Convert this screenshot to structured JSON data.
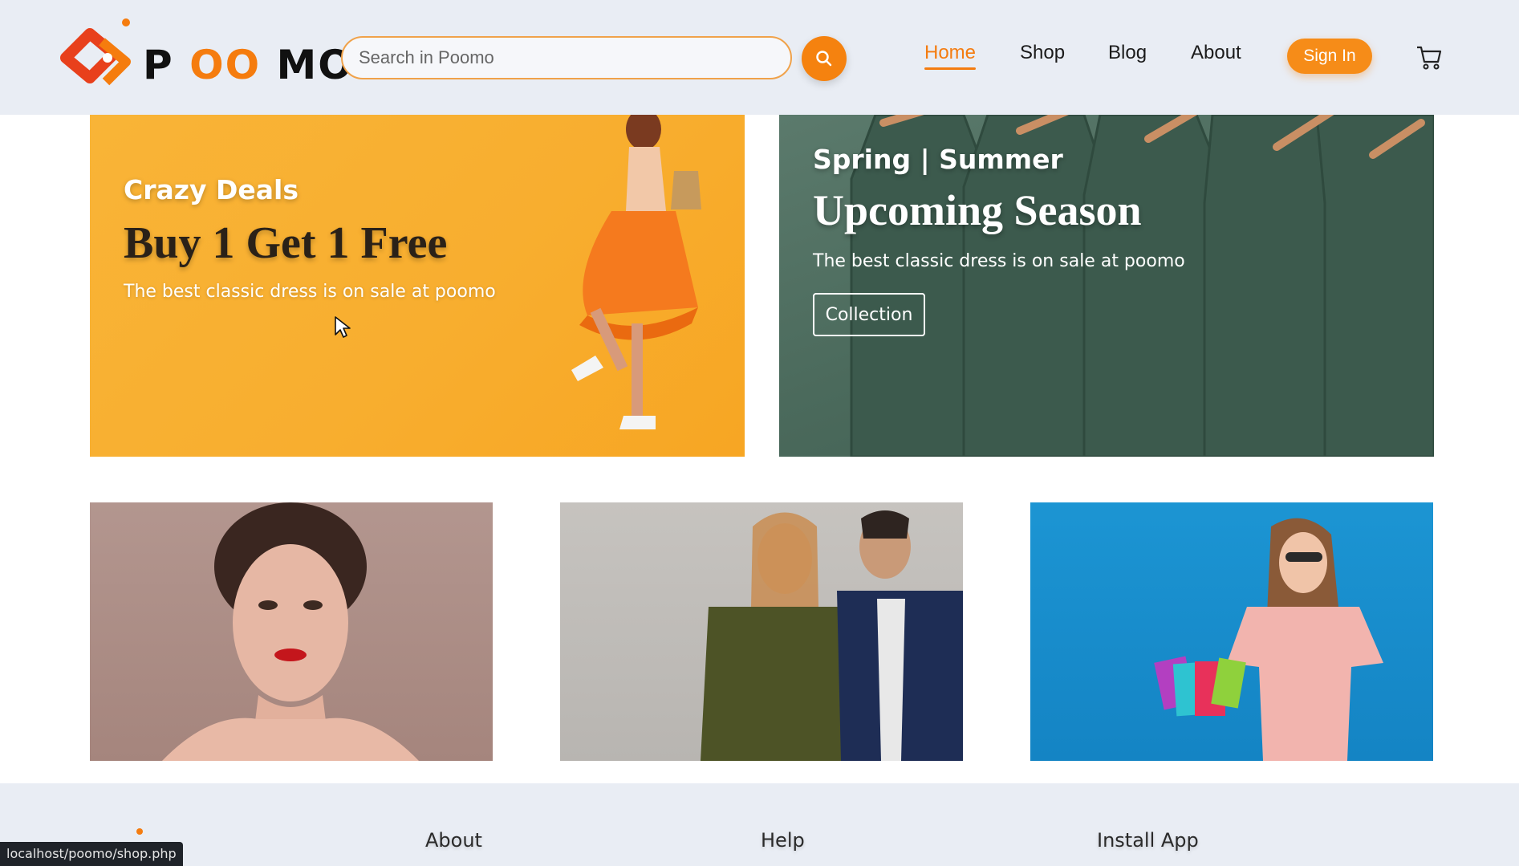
{
  "header": {
    "logo": {
      "text_left": "P",
      "text_mid": "OO",
      "text_right": "MO"
    },
    "search": {
      "placeholder": "Search in Poomo"
    },
    "nav": [
      {
        "label": "Home",
        "active": true
      },
      {
        "label": "Shop",
        "active": false
      },
      {
        "label": "Blog",
        "active": false
      },
      {
        "label": "About",
        "active": false
      }
    ],
    "signin_label": "Sign In"
  },
  "banners": {
    "deals": {
      "kicker": "Crazy Deals",
      "title": "Buy 1 Get 1 Free",
      "subtitle": "The best classic dress is on sale at poomo"
    },
    "season": {
      "kicker": "Spring | Summer",
      "title": "Upcoming Season",
      "subtitle": "The best classic dress is on sale at poomo",
      "button_label": "Collection"
    }
  },
  "cards": [
    {
      "icon": "woman-portrait-photo"
    },
    {
      "icon": "couple-jackets-photo"
    },
    {
      "icon": "shopping-woman-photo"
    }
  ],
  "footer": {
    "columns": [
      "About",
      "Help",
      "Install App"
    ]
  },
  "statusbar": {
    "url": "localhost/poomo/shop.php"
  },
  "colors": {
    "accent": "#f5820f",
    "header_bg": "#e9edf4",
    "deals_bg": "#f8ae2f",
    "season_bg": "#4b6a5c",
    "card3_bg": "#1484c4"
  }
}
